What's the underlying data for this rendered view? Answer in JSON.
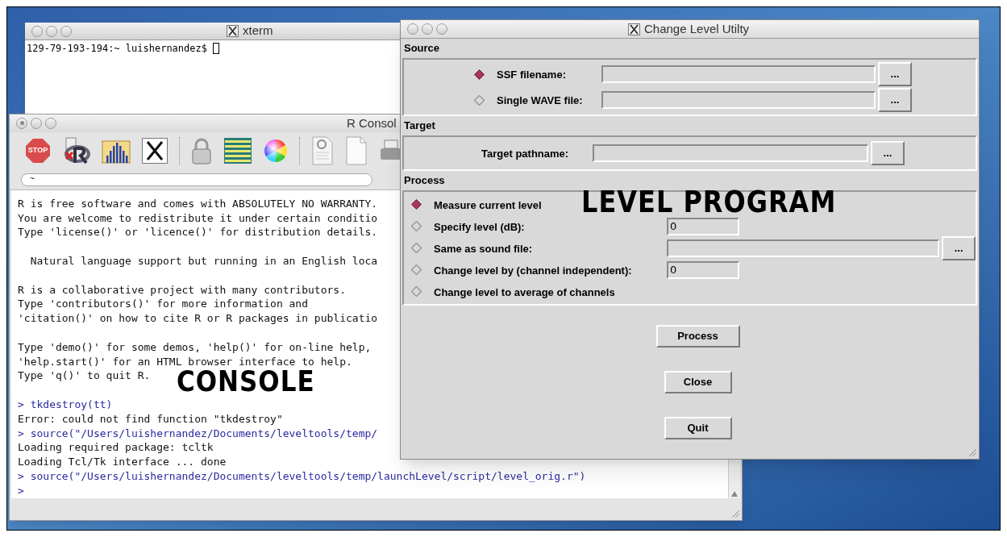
{
  "xterm": {
    "title": "xterm",
    "prompt": "129-79-193-194:~ luishernandez$"
  },
  "r_console": {
    "title": "R Consol",
    "toolbar": [
      {
        "kind": "stop",
        "label": "STOP"
      },
      {
        "kind": "r-script"
      },
      {
        "kind": "chart"
      },
      {
        "kind": "x11"
      },
      {
        "kind": "separator"
      },
      {
        "kind": "lock"
      },
      {
        "kind": "table"
      },
      {
        "kind": "color-wheel"
      },
      {
        "kind": "separator"
      },
      {
        "kind": "document"
      },
      {
        "kind": "blank-page"
      },
      {
        "kind": "printer"
      }
    ],
    "path": "~",
    "blocks": [
      [
        {
          "kind": "output",
          "text": "R is free software and comes with ABSOLUTELY NO WARRANTY."
        },
        {
          "kind": "output",
          "text": "You are welcome to redistribute it under certain conditio"
        },
        {
          "kind": "output",
          "text": "Type 'license()' or 'licence()' for distribution details."
        }
      ],
      [
        {
          "kind": "output",
          "text": "  Natural language support but running in an English loca"
        }
      ],
      [
        {
          "kind": "output",
          "text": "R is a collaborative project with many contributors."
        },
        {
          "kind": "output",
          "text": "Type 'contributors()' for more information and"
        },
        {
          "kind": "output",
          "text": "'citation()' on how to cite R or R packages in publicatio"
        }
      ],
      [
        {
          "kind": "output",
          "text": "Type 'demo()' for some demos, 'help()' for on-line help,"
        },
        {
          "kind": "output",
          "text": "'help.start()' for an HTML browser interface to help."
        },
        {
          "kind": "output",
          "text": "Type 'q()' to quit R."
        }
      ],
      [
        {
          "kind": "input",
          "text": "> tkdestroy(tt)"
        },
        {
          "kind": "output",
          "text": "Error: could not find function \"tkdestroy\""
        },
        {
          "kind": "input",
          "text": "> source(\"/Users/luishernandez/Documents/leveltools/temp/"
        },
        {
          "kind": "output",
          "text": "Loading required package: tcltk"
        },
        {
          "kind": "output",
          "text": "Loading Tcl/Tk interface ... done"
        },
        {
          "kind": "input",
          "text": "> source(\"/Users/luishernandez/Documents/leveltools/temp/launchLevel/script/level_orig.r\")"
        },
        {
          "kind": "input",
          "text": ">"
        }
      ]
    ]
  },
  "level_utility": {
    "title": "Change Level Utilty",
    "sections": [
      {
        "kind": "source",
        "title": "Source",
        "rows": [
          {
            "kind": "radio-file",
            "label": "SSF filename:",
            "selected": true,
            "browse": "..."
          },
          {
            "kind": "radio-file",
            "label": "Single WAVE file:",
            "selected": false,
            "browse": "..."
          }
        ]
      },
      {
        "kind": "target",
        "title": "Target",
        "rows": [
          {
            "kind": "file",
            "label": "Target pathname:",
            "browse": "..."
          }
        ]
      },
      {
        "kind": "process",
        "title": "Process",
        "rows": [
          {
            "kind": "radio",
            "label": "Measure current level",
            "selected": true
          },
          {
            "kind": "radio-value",
            "label": "Specify level (dB):",
            "selected": false,
            "value": "0"
          },
          {
            "kind": "radio-file",
            "label": "Same as sound file:",
            "selected": false,
            "browse": "..."
          },
          {
            "kind": "radio-value",
            "label": "Change level by (channel independent):",
            "selected": false,
            "value": "0"
          },
          {
            "kind": "radio",
            "label": "Change level to average of channels",
            "selected": false
          }
        ]
      }
    ],
    "buttons": [
      "Process",
      "Close",
      "Quit"
    ]
  },
  "annotations": [
    {
      "kind": "console",
      "text": "CONSOLE"
    },
    {
      "kind": "level",
      "text": "LEVEL PROGRAM"
    }
  ]
}
